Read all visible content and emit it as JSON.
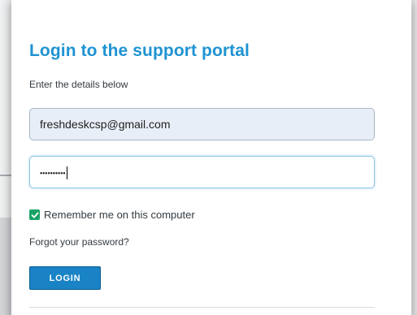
{
  "login": {
    "title": "Login to the support portal",
    "subtitle": "Enter the details below",
    "email_value": "freshdeskcsp@gmail.com",
    "password_masked": "••••••••••",
    "remember_label": "Remember me on this computer",
    "remember_checked": true,
    "forgot_label": "Forgot your password?",
    "login_button": "LOGIN"
  },
  "icons": {
    "checkbox": "checkmark-icon"
  },
  "colors": {
    "title": "#1f93d2",
    "button": "#1a83c6",
    "checkbox": "#1aa367",
    "email_field_bg": "#e8eef7"
  }
}
